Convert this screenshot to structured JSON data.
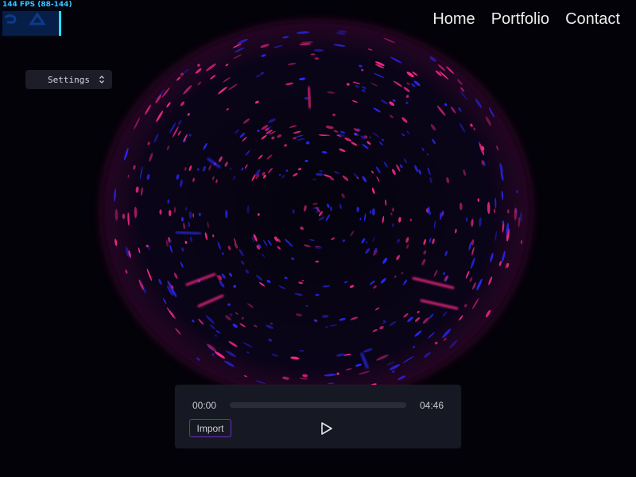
{
  "stats": {
    "fps_text": "144 FPS (88-144)"
  },
  "nav": {
    "items": [
      {
        "label": "Home"
      },
      {
        "label": "Portfolio"
      },
      {
        "label": "Contact"
      }
    ]
  },
  "settings": {
    "label": "Settings"
  },
  "player": {
    "current_time": "00:00",
    "total_time": "04:46",
    "progress": 0,
    "import_label": "Import"
  },
  "icons": {
    "settings_chevron": "chevron-up-down-icon",
    "play": "play-icon"
  },
  "colors": {
    "background": "#030208",
    "visual_blue": "#2a2aff",
    "visual_magenta": "#ff2a8a",
    "accent_purple": "#6a2fbf",
    "fps_cyan": "#35c6ff"
  }
}
